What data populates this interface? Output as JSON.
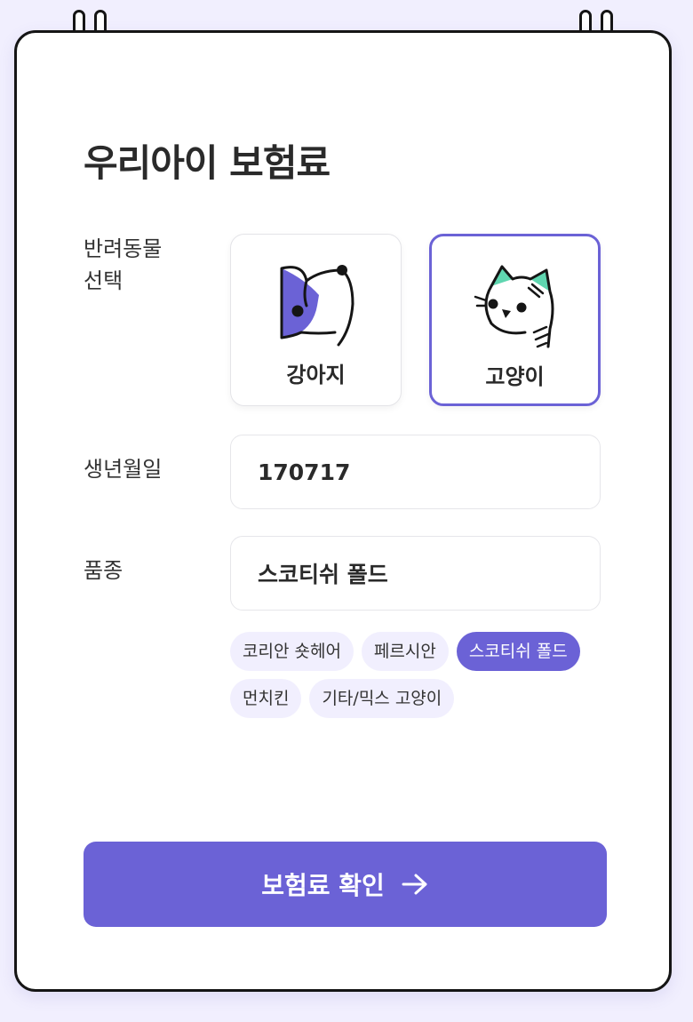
{
  "form": {
    "title": "우리아이 보험료",
    "pet_label": "반려동물 선택",
    "birth_label": "생년월일",
    "breed_label": "품종"
  },
  "pets": [
    {
      "name": "강아지",
      "icon": "dog-icon",
      "selected": false
    },
    {
      "name": "고양이",
      "icon": "cat-icon",
      "selected": true
    }
  ],
  "birthdate": {
    "value": "170717"
  },
  "breed": {
    "value": "스코티쉬 폴드",
    "options": [
      {
        "label": "코리안 숏헤어",
        "selected": false
      },
      {
        "label": "페르시안",
        "selected": false
      },
      {
        "label": "스코티쉬 폴드",
        "selected": true
      },
      {
        "label": "먼치킨",
        "selected": false
      },
      {
        "label": "기타/믹스 고양이",
        "selected": false
      }
    ]
  },
  "submit": {
    "label": "보험료 확인",
    "icon": "arrow-right-icon"
  },
  "colors": {
    "accent": "#6b62d6",
    "accent_light": "#f1effe",
    "cat_ear": "#5fd6b0"
  }
}
